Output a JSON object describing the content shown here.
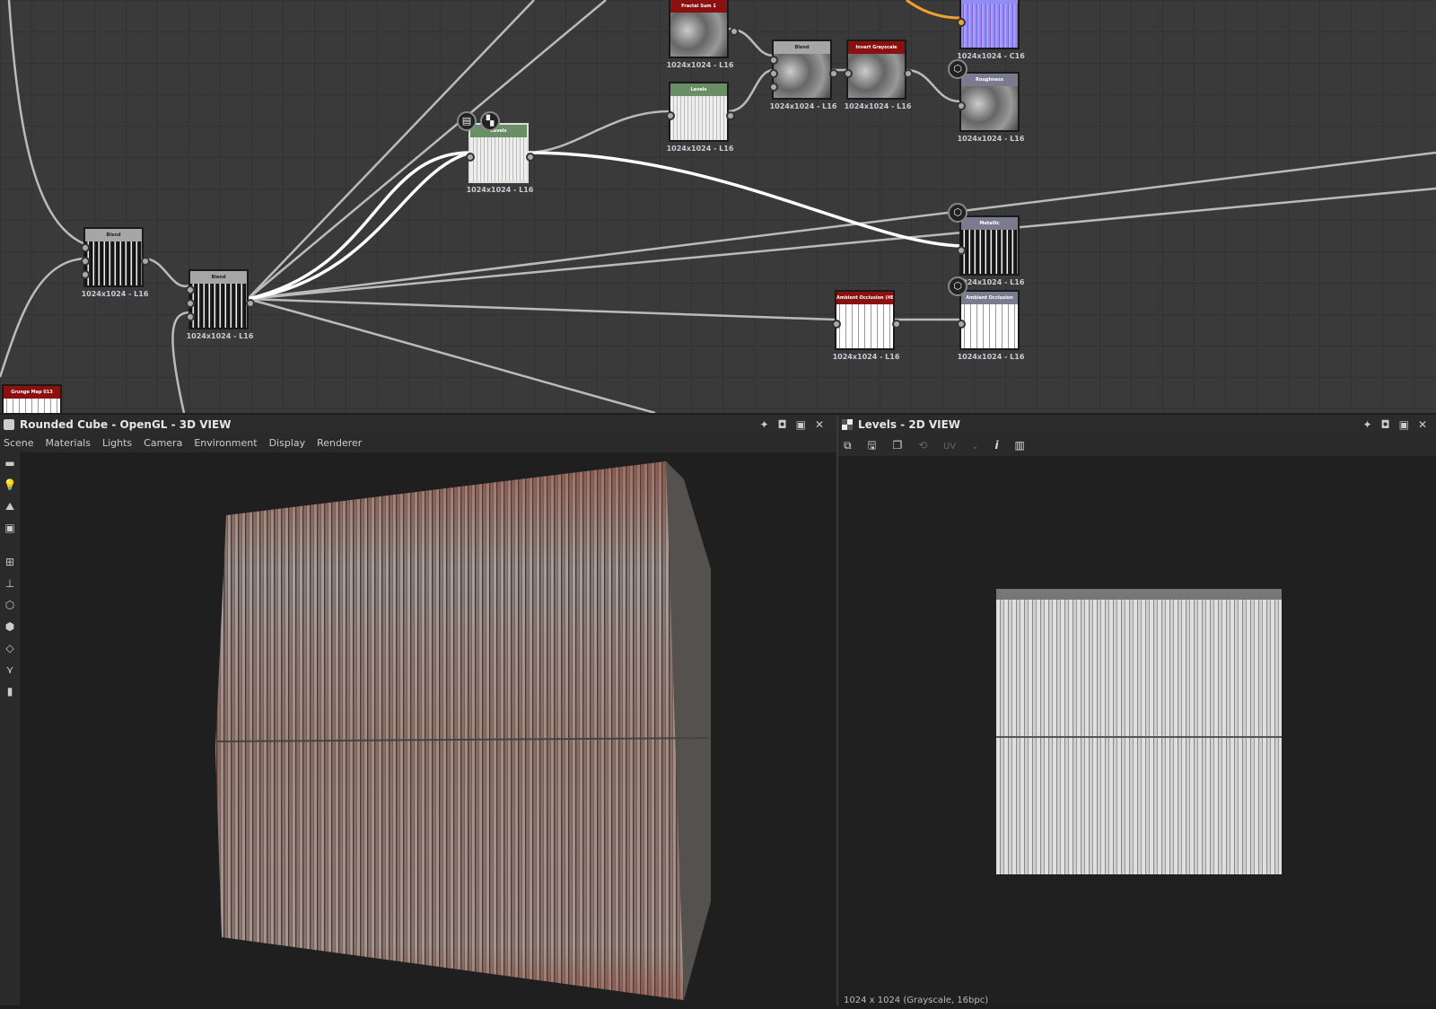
{
  "graph": {
    "nodes": [
      {
        "title": "Fractal Sum 1",
        "resolution": "1024x1024 - L16",
        "header_color": "#8b1010"
      },
      {
        "title": "Blend",
        "resolution": "1024x1024 - L16",
        "header_color": "#a6a6a6"
      },
      {
        "title": "Invert Grayscale",
        "resolution": "1024x1024 - L16",
        "header_color": "#8b1010"
      },
      {
        "title": "",
        "resolution": "1024x1024 - C16",
        "header_color": "#8f8cf5"
      },
      {
        "title": "Roughness",
        "resolution": "1024x1024 - L16",
        "header_color": "#7a7a90"
      },
      {
        "title": "Levels",
        "resolution": "1024x1024 - L16",
        "header_color": "#6a8f66"
      },
      {
        "title": "Levels",
        "resolution": "1024x1024 - L16",
        "header_color": "#6a8f66"
      },
      {
        "title": "Metallic",
        "resolution": "1024x1024 - L16",
        "header_color": "#7a7a90"
      },
      {
        "title": "Ambient Occlusion (HB...",
        "resolution": "1024x1024 - L16",
        "header_color": "#8b1010"
      },
      {
        "title": "Ambient Occlusion",
        "resolution": "1024x1024 - L16",
        "header_color": "#7a7a90"
      },
      {
        "title": "Blend",
        "resolution": "1024x1024 - L16",
        "header_color": "#a6a6a6"
      },
      {
        "title": "Blend",
        "resolution": "1024x1024 - L16",
        "header_color": "#a6a6a6"
      },
      {
        "title": "Grunge Map 013",
        "resolution": "",
        "header_color": "#8b1010"
      }
    ],
    "active_wire_color": "#f0a030"
  },
  "view3d": {
    "title": "Rounded Cube - OpenGL - 3D VIEW",
    "menu": [
      "Scene",
      "Materials",
      "Lights",
      "Camera",
      "Environment",
      "Display",
      "Renderer"
    ],
    "tools": [
      "camera-icon",
      "light-icon",
      "environment-icon",
      "display-icon",
      "grid-icon",
      "axis-icon",
      "cube-icon",
      "cube-wire-icon",
      "plane-icon",
      "normals-icon",
      "histogram-icon"
    ]
  },
  "view2d": {
    "title": "Levels - 2D VIEW",
    "uv_label": "UV",
    "info_label": "i",
    "status": "1024 x 1024 (Grayscale, 16bpc)"
  }
}
